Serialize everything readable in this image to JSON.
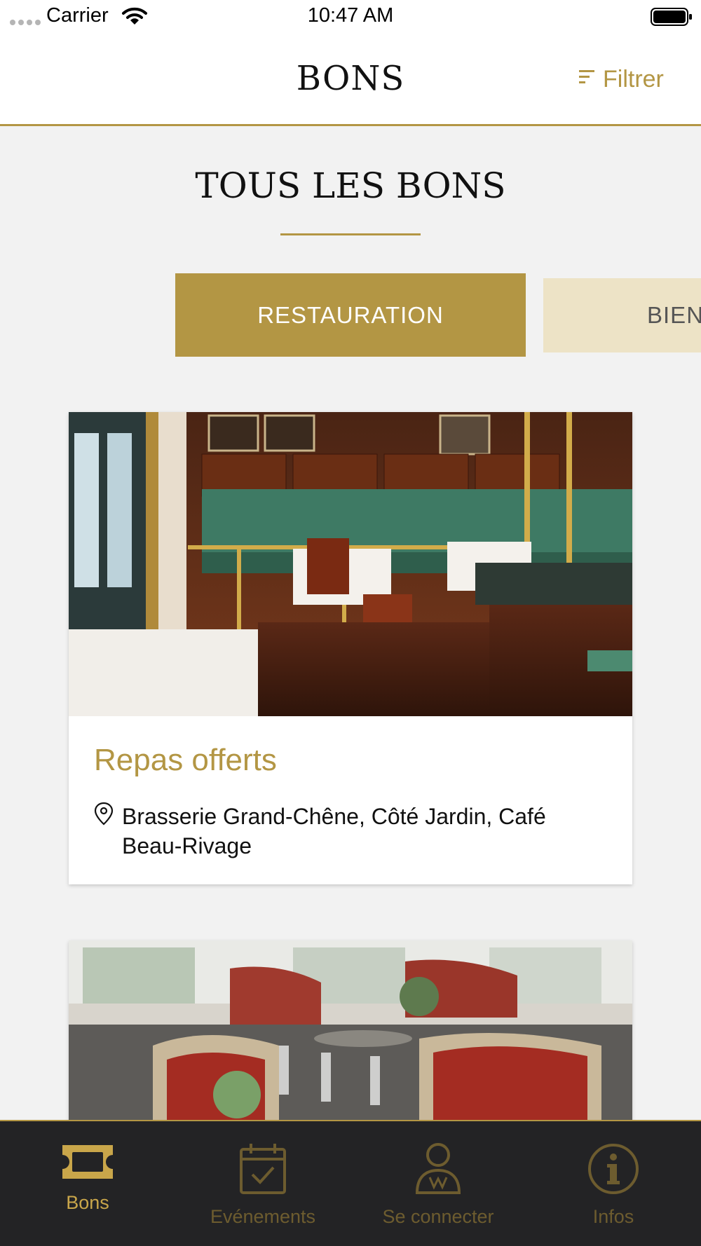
{
  "status_bar": {
    "carrier": "Carrier",
    "time": "10:47 AM"
  },
  "header": {
    "title": "BONS",
    "filter_label": "Filtrer"
  },
  "page": {
    "section_title": "TOUS LES BONS"
  },
  "categories": [
    {
      "label": "RESTAURATION",
      "active": true
    },
    {
      "label": "BIEN-",
      "active": false
    }
  ],
  "cards": [
    {
      "title": "Repas offerts",
      "location": "Brasserie Grand-Chêne, Côté Jardin, Café Beau-Rivage",
      "image": "brasserie-interior"
    },
    {
      "title": "",
      "location": "",
      "image": "dining-room-red-chairs"
    }
  ],
  "tab_bar": {
    "items": [
      {
        "label": "Bons",
        "icon": "ticket-icon",
        "active": true
      },
      {
        "label": "Evénements",
        "icon": "calendar-check-icon",
        "active": false
      },
      {
        "label": "Se connecter",
        "icon": "person-icon",
        "active": false
      },
      {
        "label": "Infos",
        "icon": "info-icon",
        "active": false
      }
    ]
  },
  "colors": {
    "accent": "#b39644",
    "accent_light": "#ede3c6",
    "tabbar_bg": "#232325",
    "page_bg": "#f2f2f2"
  }
}
